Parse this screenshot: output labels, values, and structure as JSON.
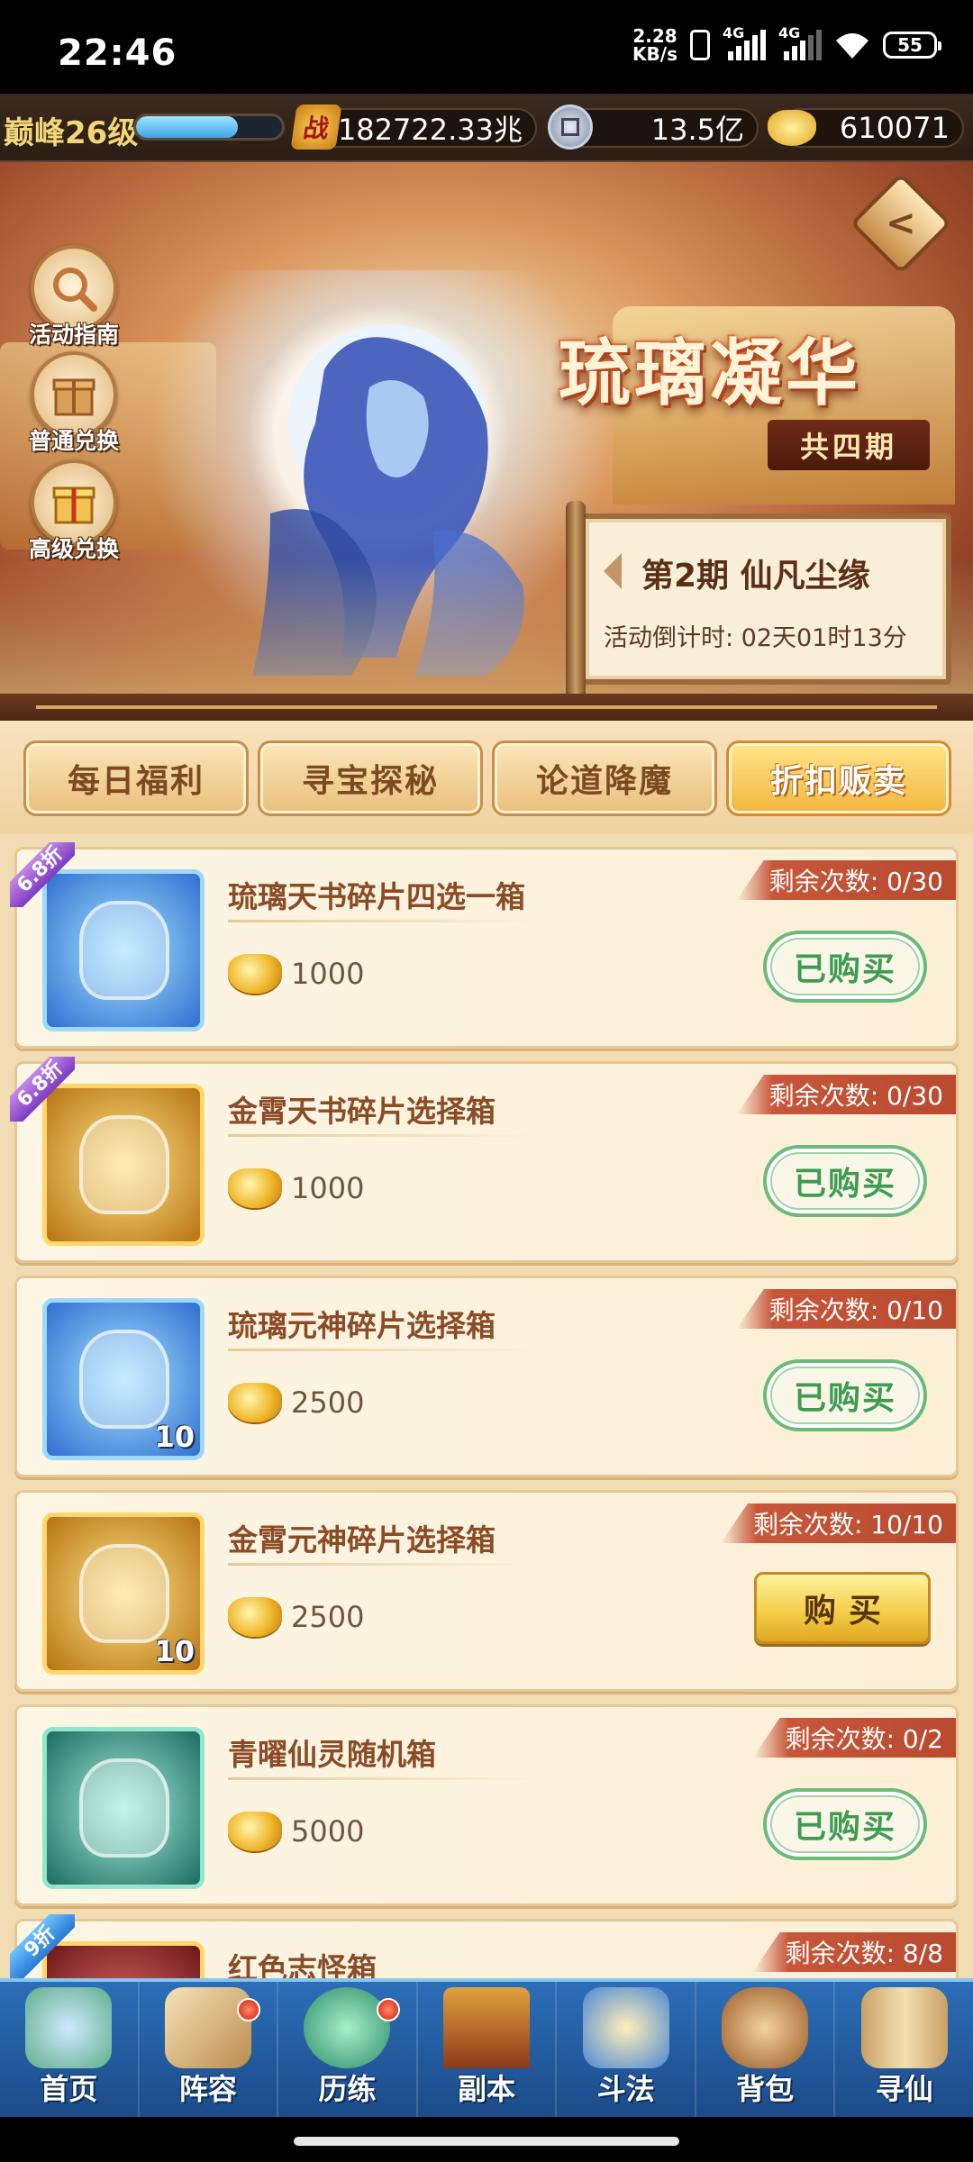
{
  "status_bar": {
    "time": "22:46",
    "net_speed": "2.28",
    "net_unit": "KB/s",
    "signal1": "4G",
    "signal2": "4G",
    "battery": "55"
  },
  "resources": {
    "level": "巅峰26级",
    "xp_fraction": 0.7,
    "power_icon": "战",
    "power": "182722.33兆",
    "coins": "13.5亿",
    "gold": "610071"
  },
  "banner": {
    "title": "琉璃凝华",
    "periods": "共四期",
    "current_period": "第2期  仙凡尘缘",
    "countdown": "活动倒计时: 02天01时13分",
    "side_buttons": [
      {
        "label": "活动指南",
        "icon": "magnifier-icon"
      },
      {
        "label": "普通兑换",
        "icon": "gift-box-icon"
      },
      {
        "label": "高级兑换",
        "icon": "gift-box-icon"
      }
    ]
  },
  "tabs": [
    {
      "label": "每日福利",
      "active": false
    },
    {
      "label": "寻宝探秘",
      "active": false
    },
    {
      "label": "论道降魔",
      "active": false
    },
    {
      "label": "折扣贩卖",
      "active": true
    }
  ],
  "items": [
    {
      "name": "琉璃天书碎片四选一箱",
      "price": "1000",
      "remaining": "剩余次数: 0/30",
      "action": "已购买",
      "discount": "6.8折",
      "thumb_style": "blue",
      "count": ""
    },
    {
      "name": "金霄天书碎片选择箱",
      "price": "1000",
      "remaining": "剩余次数: 0/30",
      "action": "已购买",
      "discount": "6.8折",
      "thumb_style": "gold",
      "count": ""
    },
    {
      "name": "琉璃元神碎片选择箱",
      "price": "2500",
      "remaining": "剩余次数: 0/10",
      "action": "已购买",
      "discount": "",
      "thumb_style": "blue",
      "count": "10"
    },
    {
      "name": "金霄元神碎片选择箱",
      "price": "2500",
      "remaining": "剩余次数: 10/10",
      "action": "购买",
      "discount": "",
      "thumb_style": "gold",
      "count": "10"
    },
    {
      "name": "青曜仙灵随机箱",
      "price": "5000",
      "remaining": "剩余次数: 0/2",
      "action": "已购买",
      "discount": "",
      "thumb_style": "teal",
      "count": ""
    },
    {
      "name": "红色志怪箱",
      "price": "",
      "remaining": "剩余次数: 8/8",
      "action": "",
      "discount": "9折",
      "thumb_style": "red",
      "count": ""
    }
  ],
  "bottom_nav": [
    {
      "label": "首页",
      "icon": "home-mountain-icon",
      "dot": false
    },
    {
      "label": "阵容",
      "icon": "cards-icon",
      "dot": true
    },
    {
      "label": "历练",
      "icon": "beast-icon",
      "dot": true
    },
    {
      "label": "副本",
      "icon": "gate-icon",
      "dot": false
    },
    {
      "label": "斗法",
      "icon": "sword-icon",
      "dot": false
    },
    {
      "label": "背包",
      "icon": "bag-icon",
      "dot": false
    },
    {
      "label": "寻仙",
      "icon": "scroll-icon",
      "dot": false
    }
  ],
  "colors": {
    "accent_gold": "#f2b63f",
    "bought_green": "#3e9b52",
    "remain_red": "#c7563a",
    "nav_blue": "#2c6eb8"
  }
}
